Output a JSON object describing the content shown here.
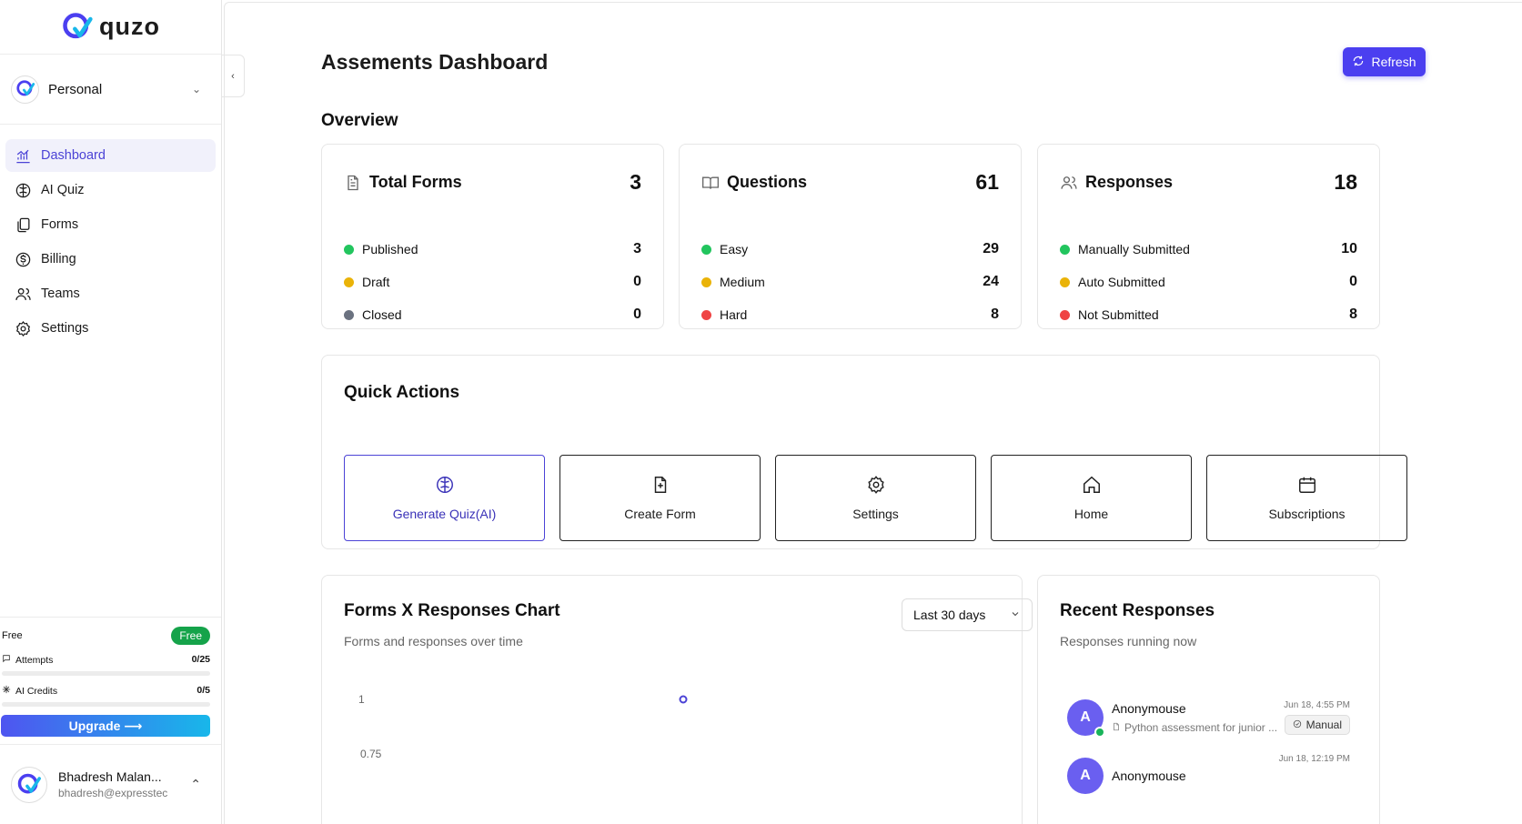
{
  "brand": {
    "name": "quzo",
    "accent": "#4b3ff0"
  },
  "workspace": {
    "name": "Personal"
  },
  "sidebar": {
    "items": [
      {
        "label": "Dashboard",
        "icon": "chart-icon",
        "active": true
      },
      {
        "label": "AI Quiz",
        "icon": "brain-icon",
        "active": false
      },
      {
        "label": "Forms",
        "icon": "files-icon",
        "active": false
      },
      {
        "label": "Billing",
        "icon": "dollar-icon",
        "active": false
      },
      {
        "label": "Teams",
        "icon": "users-icon",
        "active": false
      },
      {
        "label": "Settings",
        "icon": "gear-icon",
        "active": false
      }
    ]
  },
  "plan": {
    "label": "Free",
    "badge": "Free",
    "attempts": {
      "label": "Attempts",
      "value": "0/25",
      "fraction": 0
    },
    "ai_credits": {
      "label": "AI Credits",
      "value": "0/5",
      "fraction": 0
    },
    "upgrade_label": "Upgrade ⟶"
  },
  "user": {
    "name": "Bhadresh Malan...",
    "email": "bhadresh@expresstec"
  },
  "header": {
    "title": "Assements Dashboard",
    "refresh_label": "Refresh"
  },
  "overview": {
    "title": "Overview",
    "cards": [
      {
        "title": "Total Forms",
        "value": "3",
        "icon": "document-icon",
        "rows": [
          {
            "label": "Published",
            "value": "3",
            "color": "#22c55e"
          },
          {
            "label": "Draft",
            "value": "0",
            "color": "#eab308"
          },
          {
            "label": "Closed",
            "value": "0",
            "color": "#6b7280"
          }
        ]
      },
      {
        "title": "Questions",
        "value": "61",
        "icon": "book-icon",
        "rows": [
          {
            "label": "Easy",
            "value": "29",
            "color": "#22c55e"
          },
          {
            "label": "Medium",
            "value": "24",
            "color": "#eab308"
          },
          {
            "label": "Hard",
            "value": "8",
            "color": "#ef4444"
          }
        ]
      },
      {
        "title": "Responses",
        "value": "18",
        "icon": "users-icon",
        "rows": [
          {
            "label": "Manually Submitted",
            "value": "10",
            "color": "#22c55e"
          },
          {
            "label": "Auto Submitted",
            "value": "0",
            "color": "#eab308"
          },
          {
            "label": "Not Submitted",
            "value": "8",
            "color": "#ef4444"
          }
        ]
      }
    ]
  },
  "quick_actions": {
    "title": "Quick Actions",
    "items": [
      {
        "label": "Generate Quiz(AI)",
        "icon": "brain-icon"
      },
      {
        "label": "Create Form",
        "icon": "file-plus-icon"
      },
      {
        "label": "Settings",
        "icon": "gear-icon"
      },
      {
        "label": "Home",
        "icon": "home-icon"
      },
      {
        "label": "Subscriptions",
        "icon": "calendar-icon"
      }
    ]
  },
  "chart_panel": {
    "title": "Forms X Responses Chart",
    "subtitle": "Forms and responses over time",
    "range": "Last 30 days"
  },
  "chart_data": {
    "type": "line",
    "title": "Forms X Responses Chart",
    "y_ticks": [
      "1",
      "0.75"
    ],
    "points": [
      {
        "y": 1
      }
    ]
  },
  "recent": {
    "title": "Recent Responses",
    "subtitle": "Responses running now",
    "items": [
      {
        "initial": "A",
        "name": "Anonymouse",
        "desc": "Python assessment for junior ...",
        "time": "Jun 18, 4:55 PM",
        "badge": "Manual"
      },
      {
        "initial": "A",
        "name": "Anonymouse",
        "desc": "",
        "time": "Jun 18, 12:19 PM",
        "badge": ""
      }
    ]
  }
}
